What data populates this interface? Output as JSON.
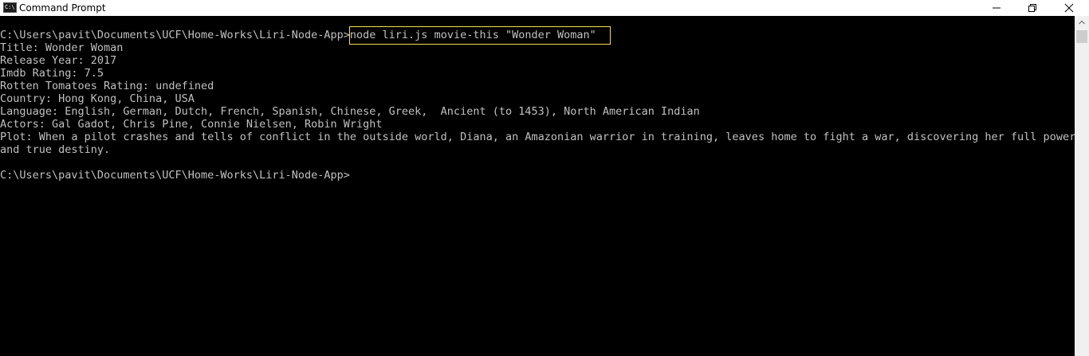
{
  "window": {
    "title": "Command Prompt",
    "icon": "cmd-icon",
    "icon_text": "C:\\"
  },
  "terminal": {
    "prompt": "C:\\Users\\pavit\\Documents\\UCF\\Home-Works\\Liri-Node-App>",
    "command": "node liri.js movie-this \"Wonder Woman\"",
    "output": [
      "Title: Wonder Woman",
      "Release Year: 2017",
      "Imdb Rating: 7.5",
      "Rotten Tomatoes Rating: undefined",
      "Country: Hong Kong, China, USA",
      "Language: English, German, Dutch, French, Spanish, Chinese, Greek,  Ancient (to 1453), North American Indian",
      "Actors: Gal Gadot, Chris Pine, Connie Nielsen, Robin Wright",
      "Plot: When a pilot crashes and tells of conflict in the outside world, Diana, an Amazonian warrior in training, leaves home to fight a war, discovering her full powers",
      "and true destiny.",
      ""
    ],
    "final_prompt": "C:\\Users\\pavit\\Documents\\UCF\\Home-Works\\Liri-Node-App>"
  },
  "colors": {
    "background": "#000000",
    "text": "#c0c0c0",
    "highlight_box": "#f4e04d"
  }
}
